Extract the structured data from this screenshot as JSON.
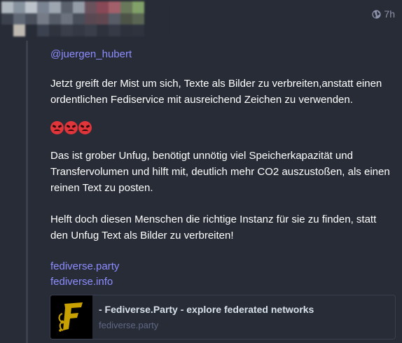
{
  "status": {
    "visibility_icon": "globe-icon",
    "relative_time": "7h",
    "mention": "@juergen_hubert",
    "paragraphs": [
      "Jetzt greift der Mist um sich, Texte als Bilder zu verbreiten,anstatt einen ordentlichen Fediservice mit ausreichend Zeichen zu verwenden.",
      "Das ist grober Unfug, benötigt unnötig viel Speicherkapazität und Transfervolumen und hilft mit, deutlich mehr CO2 auszustoßen, als einen reinen Text zu posten.",
      "Helft doch diesen Menschen die richtige Instanz für sie zu finden, statt den Unfug Text als Bilder zu verbreiten!"
    ],
    "emojis": [
      "angry-face-emoji",
      "angry-face-emoji",
      "angry-face-emoji"
    ],
    "links": [
      "fediverse.party",
      "fediverse.info"
    ]
  },
  "card": {
    "title": "- Fediverse.Party - explore federated networks",
    "host": "fediverse.party",
    "thumbnail_icon": "fediverse-party-logo"
  },
  "colors": {
    "background": "#282c37",
    "link": "#8c8dff",
    "muted": "#8d93ab",
    "thumb_accent": "#c8a000"
  }
}
